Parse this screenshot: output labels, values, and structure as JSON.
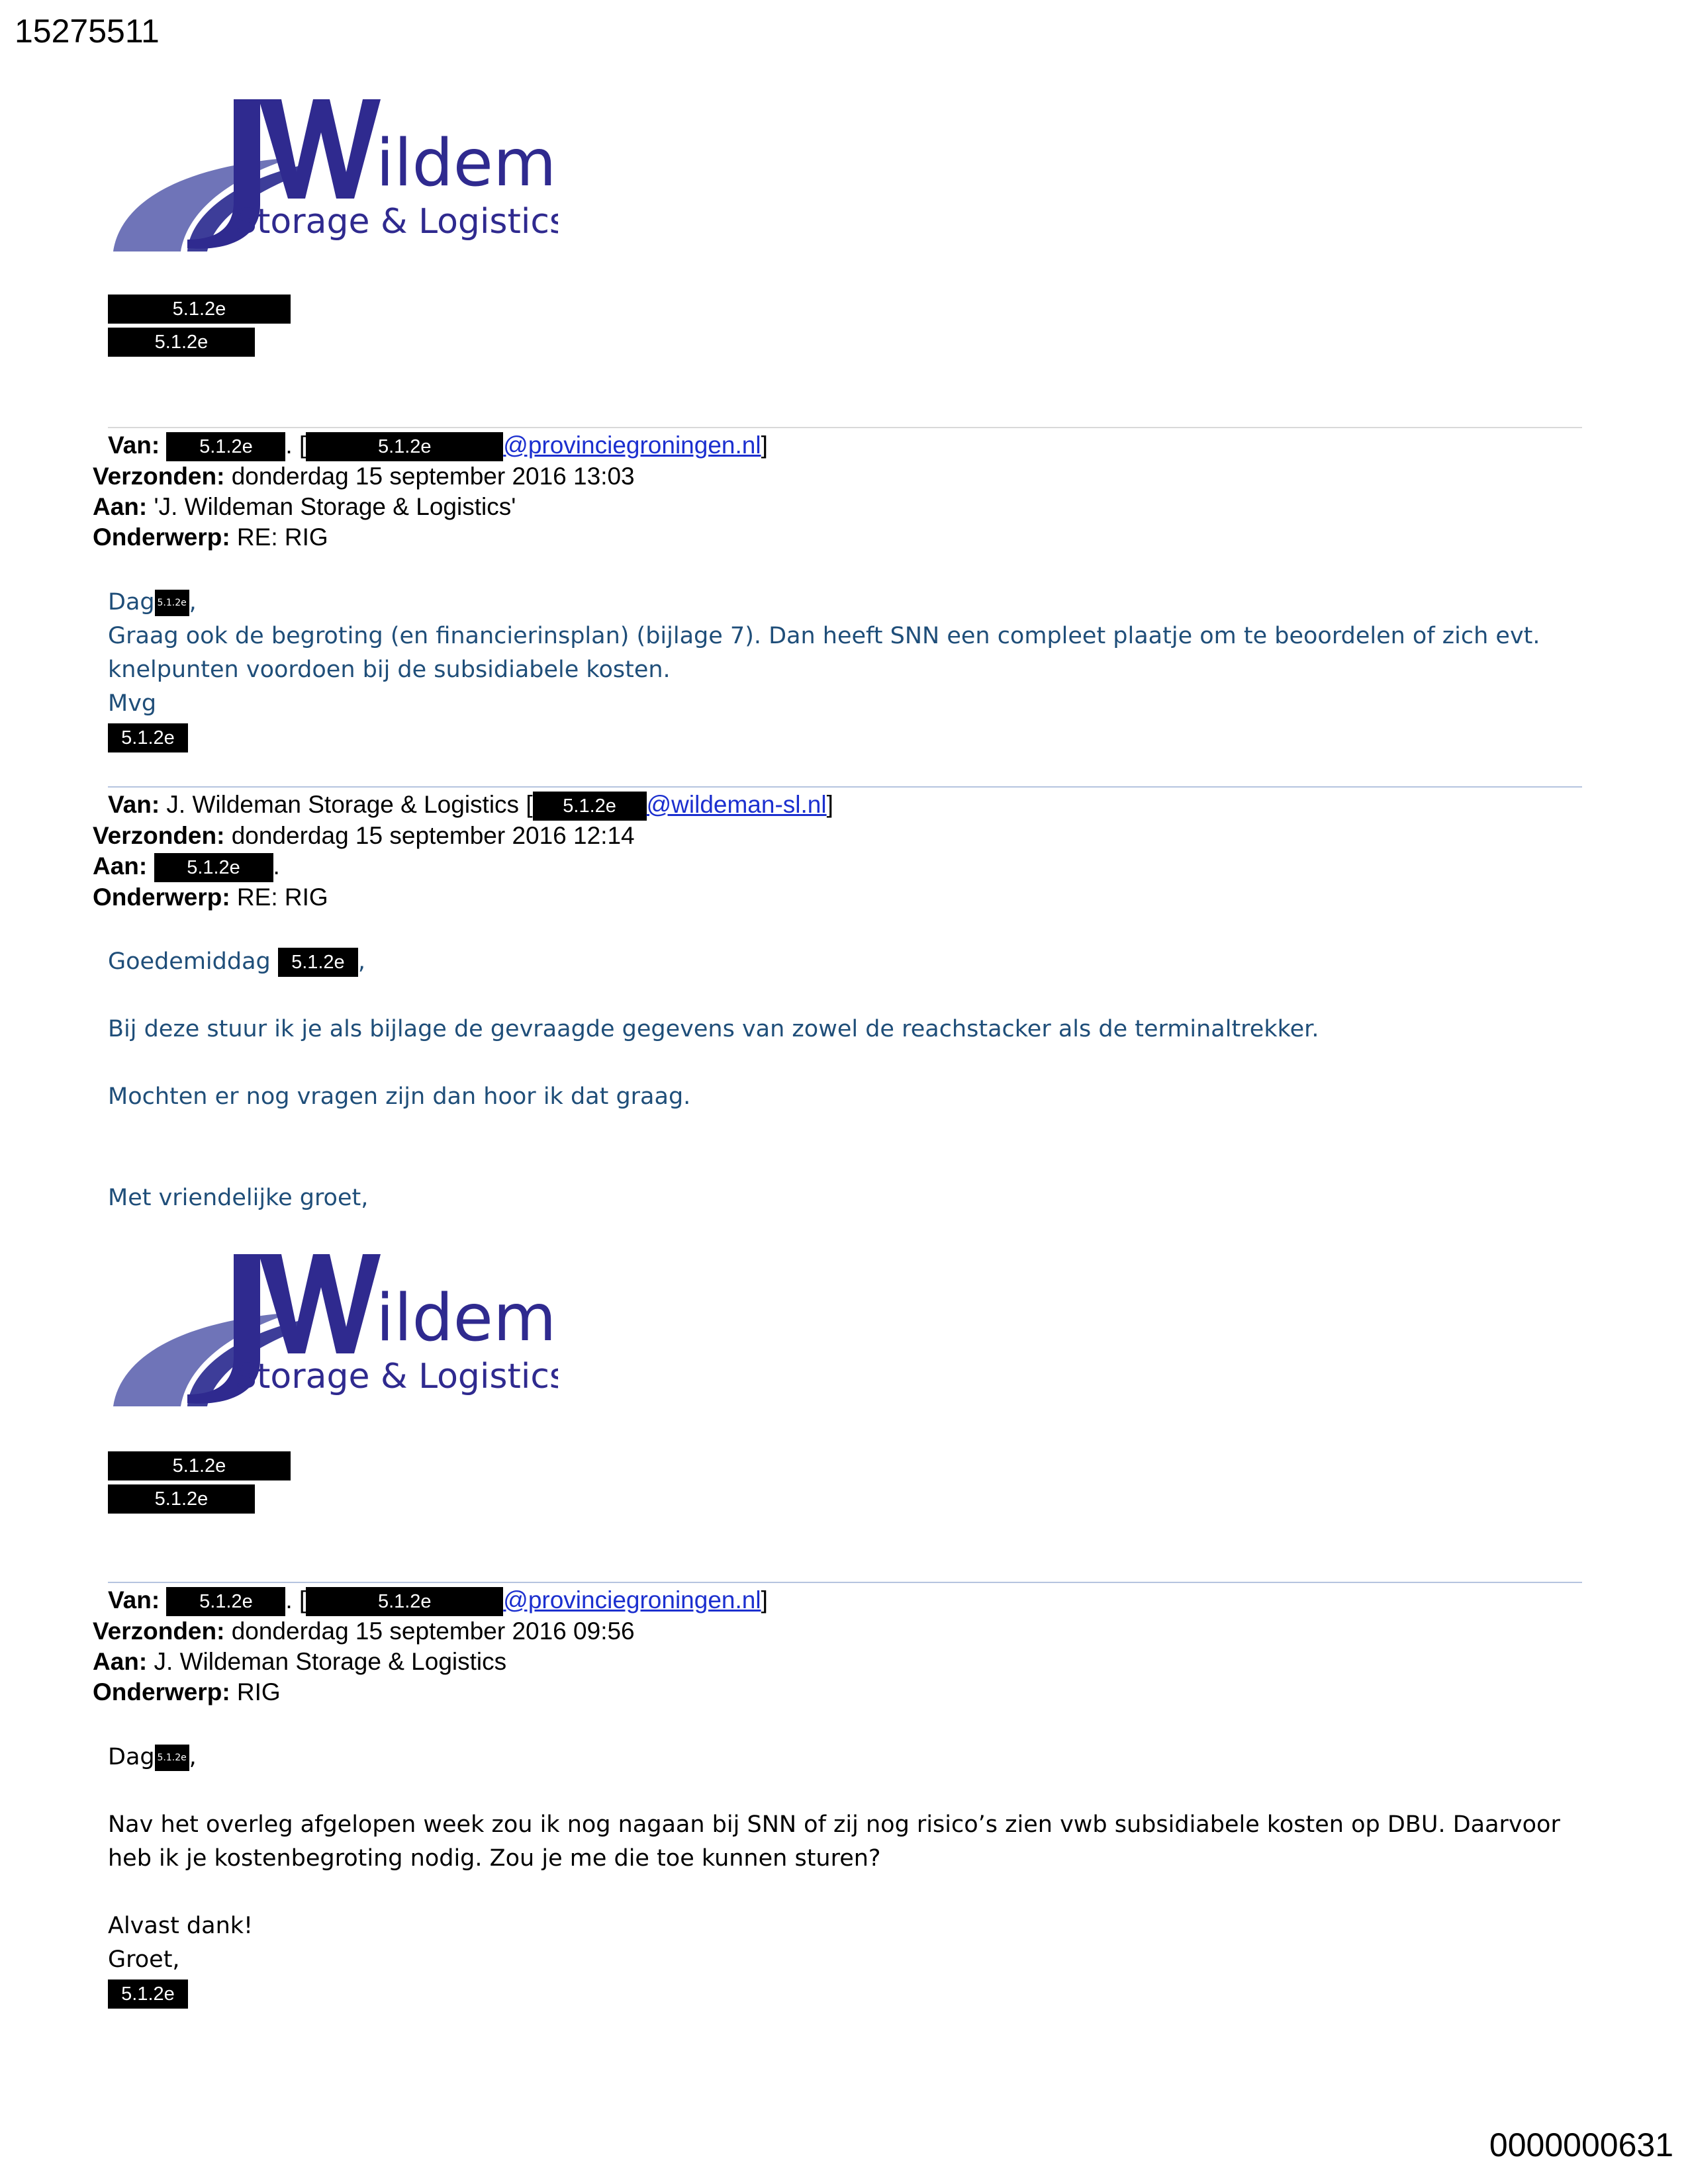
{
  "doc_id": "15275511",
  "page_number": "0000000631",
  "logo": {
    "main": "ildeman",
    "sub": "Storage & Logistics",
    "colors": {
      "primary": "#2f2a8f",
      "swoosh": "#6f74b8"
    }
  },
  "redaction_code": "5.1.2e",
  "signature": {
    "line1": "5.1.2e",
    "line2": "5.1.2e"
  },
  "email1": {
    "van_label": "Van:",
    "van_name": "5.1.2e",
    "van_email_redacted": "5.1.2e",
    "van_domain": "@provinciegroningen.nl",
    "verzonden_label": "Verzonden:",
    "verzonden": "donderdag 15 september 2016 13:03",
    "aan_label": "Aan:",
    "aan": "'J. Wildeman Storage & Logistics'",
    "onderwerp_label": "Onderwerp:",
    "onderwerp": "RE: RIG",
    "greeting": "Dag",
    "body": "Graag ook de begroting (en financierinsplan) (bijlage 7). Dan heeft SNN een compleet plaatje om te beoordelen of zich evt. knelpunten voordoen bij de subsidiabele kosten.",
    "closing": "Mvg"
  },
  "email2": {
    "van_label": "Van:",
    "van_name": "J. Wildeman Storage & Logistics [",
    "van_email_redacted": "5.1.2e",
    "van_domain": "@wildeman-sl.nl",
    "verzonden_label": "Verzonden:",
    "verzonden": "donderdag 15 september 2016 12:14",
    "aan_label": "Aan:",
    "aan_redacted": "5.1.2e",
    "onderwerp_label": "Onderwerp:",
    "onderwerp": "RE: RIG",
    "greeting": "Goedemiddag",
    "para1": "Bij deze stuur ik je als bijlage de gevraagde gegevens van zowel de reachstacker als de terminaltrekker.",
    "para2": "Mochten er nog vragen zijn dan hoor ik dat graag.",
    "closing": "Met vriendelijke groet,"
  },
  "email3": {
    "van_label": "Van:",
    "van_name": "5.1.2e",
    "van_email_redacted": "5.1.2e",
    "van_domain": "@provinciegroningen.nl",
    "verzonden_label": "Verzonden:",
    "verzonden": "donderdag 15 september 2016 09:56",
    "aan_label": "Aan:",
    "aan": "J. Wildeman Storage & Logistics",
    "onderwerp_label": "Onderwerp:",
    "onderwerp": "RIG",
    "greeting": "Dag",
    "body": "Nav het overleg afgelopen week zou ik nog nagaan bij SNN of zij nog risico’s zien vwb subsidiabele kosten op DBU. Daarvoor heb ik je kostenbegroting nodig. Zou je me die toe kunnen sturen?",
    "thanks": "Alvast dank!",
    "closing": "Groet,"
  }
}
